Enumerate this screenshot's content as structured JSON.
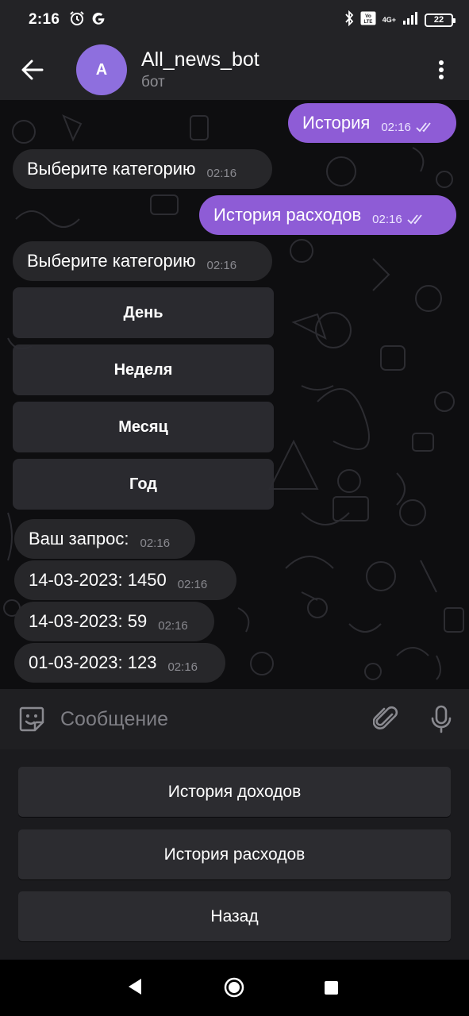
{
  "status_bar": {
    "time": "2:16",
    "network_top": "4G+",
    "battery": "22",
    "icons": [
      "alarm-icon",
      "google-icon",
      "bluetooth-icon",
      "volte-icon",
      "signal-icon",
      "battery-icon"
    ]
  },
  "header": {
    "avatar_letter": "A",
    "title": "All_news_bot",
    "subtitle": "бот",
    "avatar_color": "#8e6fde"
  },
  "messages": [
    {
      "dir": "out",
      "text": "История",
      "time": "02:16"
    },
    {
      "dir": "in",
      "text": "Выберите категорию",
      "time": "02:16"
    },
    {
      "dir": "out",
      "text": "История расходов",
      "time": "02:16"
    },
    {
      "dir": "in",
      "text": "Выберите категорию",
      "time": "02:16"
    },
    {
      "dir": "in",
      "text": "Ваш запрос:",
      "time": "02:16"
    },
    {
      "dir": "in",
      "text": "14-03-2023: 1450",
      "time": "02:16"
    },
    {
      "dir": "in",
      "text": "14-03-2023: 59",
      "time": "02:16"
    },
    {
      "dir": "in",
      "text": "01-03-2023: 123",
      "time": "02:16"
    }
  ],
  "inline_keyboard": [
    "День",
    "Неделя",
    "Месяц",
    "Год"
  ],
  "input": {
    "placeholder": "Сообщение",
    "value": ""
  },
  "reply_keyboard": [
    "История доходов",
    "История расходов",
    "Назад"
  ],
  "colors": {
    "outgoing_bubble": "#8e5cd6",
    "incoming_bubble": "#27272a",
    "header_bg": "#232326",
    "keyboard_button": "#2c2c30"
  }
}
